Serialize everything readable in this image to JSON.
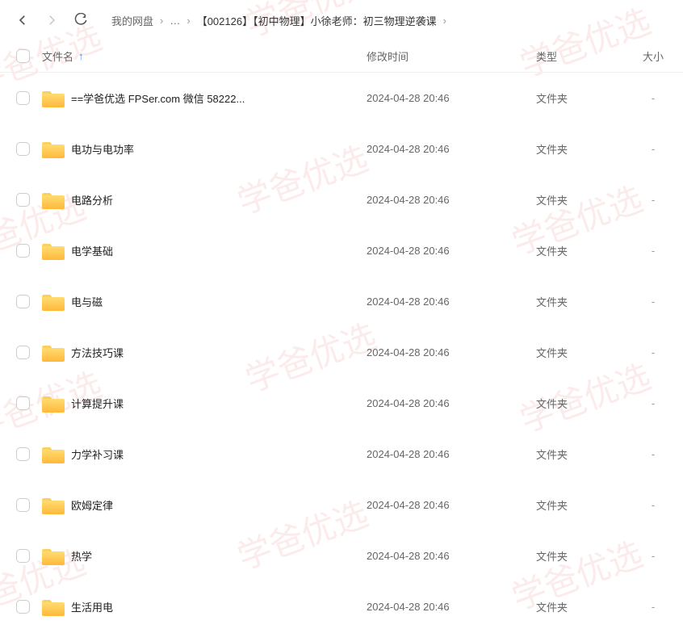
{
  "watermark_text": "学爸优选",
  "breadcrumb": {
    "root": "我的网盘",
    "ellipsis": "…",
    "current": "【002126】【初中物理】小徐老师：初三物理逆袭课"
  },
  "headers": {
    "name": "文件名",
    "time": "修改时间",
    "type": "类型",
    "size": "大小",
    "sort_arrow": "↑"
  },
  "files": [
    {
      "name": "==学爸优选 FPSer.com 微信 58222...",
      "time": "2024-04-28 20:46",
      "type": "文件夹",
      "size": "-"
    },
    {
      "name": "电功与电功率",
      "time": "2024-04-28 20:46",
      "type": "文件夹",
      "size": "-"
    },
    {
      "name": "电路分析",
      "time": "2024-04-28 20:46",
      "type": "文件夹",
      "size": "-"
    },
    {
      "name": "电学基础",
      "time": "2024-04-28 20:46",
      "type": "文件夹",
      "size": "-"
    },
    {
      "name": "电与磁",
      "time": "2024-04-28 20:46",
      "type": "文件夹",
      "size": "-"
    },
    {
      "name": "方法技巧课",
      "time": "2024-04-28 20:46",
      "type": "文件夹",
      "size": "-"
    },
    {
      "name": "计算提升课",
      "time": "2024-04-28 20:46",
      "type": "文件夹",
      "size": "-"
    },
    {
      "name": "力学补习课",
      "time": "2024-04-28 20:46",
      "type": "文件夹",
      "size": "-"
    },
    {
      "name": "欧姆定律",
      "time": "2024-04-28 20:46",
      "type": "文件夹",
      "size": "-"
    },
    {
      "name": "热学",
      "time": "2024-04-28 20:46",
      "type": "文件夹",
      "size": "-"
    },
    {
      "name": "生活用电",
      "time": "2024-04-28 20:46",
      "type": "文件夹",
      "size": "-"
    }
  ]
}
